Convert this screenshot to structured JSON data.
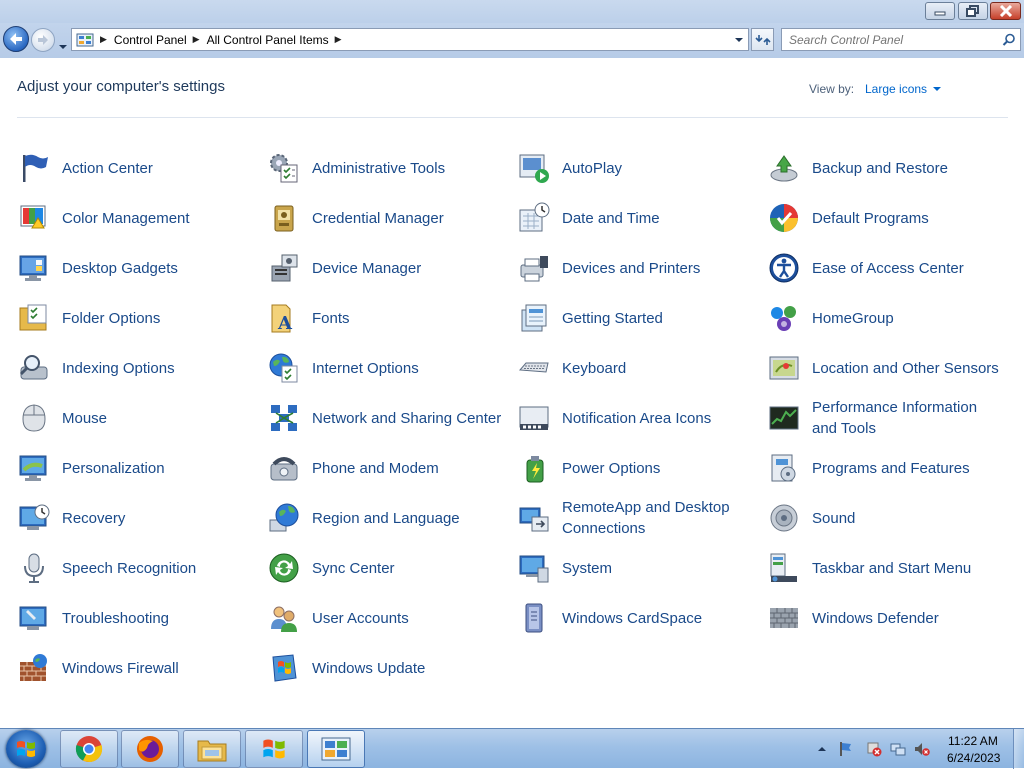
{
  "window": {
    "breadcrumbs": [
      "Control Panel",
      "All Control Panel Items"
    ],
    "search_placeholder": "Search Control Panel"
  },
  "header": {
    "title": "Adjust your computer's settings",
    "view_by_label": "View by:",
    "view_by_value": "Large icons"
  },
  "items": [
    {
      "label": "Action Center",
      "icon": "action-center-flag-icon"
    },
    {
      "label": "Administrative Tools",
      "icon": "administrative-tools-icon"
    },
    {
      "label": "AutoPlay",
      "icon": "autoplay-icon"
    },
    {
      "label": "Backup and Restore",
      "icon": "backup-restore-icon"
    },
    {
      "label": "Color Management",
      "icon": "color-management-icon"
    },
    {
      "label": "Credential Manager",
      "icon": "credential-manager-icon"
    },
    {
      "label": "Date and Time",
      "icon": "date-time-icon"
    },
    {
      "label": "Default Programs",
      "icon": "default-programs-icon"
    },
    {
      "label": "Desktop Gadgets",
      "icon": "desktop-gadgets-icon"
    },
    {
      "label": "Device Manager",
      "icon": "device-manager-icon"
    },
    {
      "label": "Devices and Printers",
      "icon": "devices-printers-icon"
    },
    {
      "label": "Ease of Access Center",
      "icon": "ease-of-access-icon"
    },
    {
      "label": "Folder Options",
      "icon": "folder-options-icon"
    },
    {
      "label": "Fonts",
      "icon": "fonts-icon"
    },
    {
      "label": "Getting Started",
      "icon": "getting-started-icon"
    },
    {
      "label": "HomeGroup",
      "icon": "homegroup-icon"
    },
    {
      "label": "Indexing Options",
      "icon": "indexing-options-icon"
    },
    {
      "label": "Internet Options",
      "icon": "internet-options-icon"
    },
    {
      "label": "Keyboard",
      "icon": "keyboard-icon"
    },
    {
      "label": "Location and Other Sensors",
      "icon": "location-sensors-icon"
    },
    {
      "label": "Mouse",
      "icon": "mouse-icon"
    },
    {
      "label": "Network and Sharing Center",
      "icon": "network-sharing-icon"
    },
    {
      "label": "Notification Area Icons",
      "icon": "notification-area-icon"
    },
    {
      "label": "Performance Information and Tools",
      "icon": "performance-icon"
    },
    {
      "label": "Personalization",
      "icon": "personalization-icon"
    },
    {
      "label": "Phone and Modem",
      "icon": "phone-modem-icon"
    },
    {
      "label": "Power Options",
      "icon": "power-options-icon"
    },
    {
      "label": "Programs and Features",
      "icon": "programs-features-icon"
    },
    {
      "label": "Recovery",
      "icon": "recovery-icon"
    },
    {
      "label": "Region and Language",
      "icon": "region-language-icon"
    },
    {
      "label": "RemoteApp and Desktop Connections",
      "icon": "remoteapp-icon"
    },
    {
      "label": "Sound",
      "icon": "sound-icon"
    },
    {
      "label": "Speech Recognition",
      "icon": "speech-recognition-icon"
    },
    {
      "label": "Sync Center",
      "icon": "sync-center-icon"
    },
    {
      "label": "System",
      "icon": "system-icon"
    },
    {
      "label": "Taskbar and Start Menu",
      "icon": "taskbar-start-menu-icon"
    },
    {
      "label": "Troubleshooting",
      "icon": "troubleshooting-icon"
    },
    {
      "label": "User Accounts",
      "icon": "user-accounts-icon"
    },
    {
      "label": "Windows CardSpace",
      "icon": "cardspace-icon"
    },
    {
      "label": "Windows Defender",
      "icon": "windows-defender-icon"
    },
    {
      "label": "Windows Firewall",
      "icon": "windows-firewall-icon"
    },
    {
      "label": "Windows Update",
      "icon": "windows-update-icon"
    }
  ],
  "taskbar": {
    "apps": [
      {
        "name": "chrome",
        "icon": "chrome-icon"
      },
      {
        "name": "firefox",
        "icon": "firefox-icon"
      },
      {
        "name": "explorer",
        "icon": "file-explorer-icon"
      },
      {
        "name": "windows",
        "icon": "windows-logo-icon"
      },
      {
        "name": "control-panel",
        "icon": "control-panel-icon",
        "active": true
      }
    ],
    "clock": {
      "time": "11:22 AM",
      "date": "6/24/2023"
    }
  },
  "colors": {
    "link": "#1a4a8a",
    "heading": "#1e395b",
    "accent": "#0066cc"
  }
}
